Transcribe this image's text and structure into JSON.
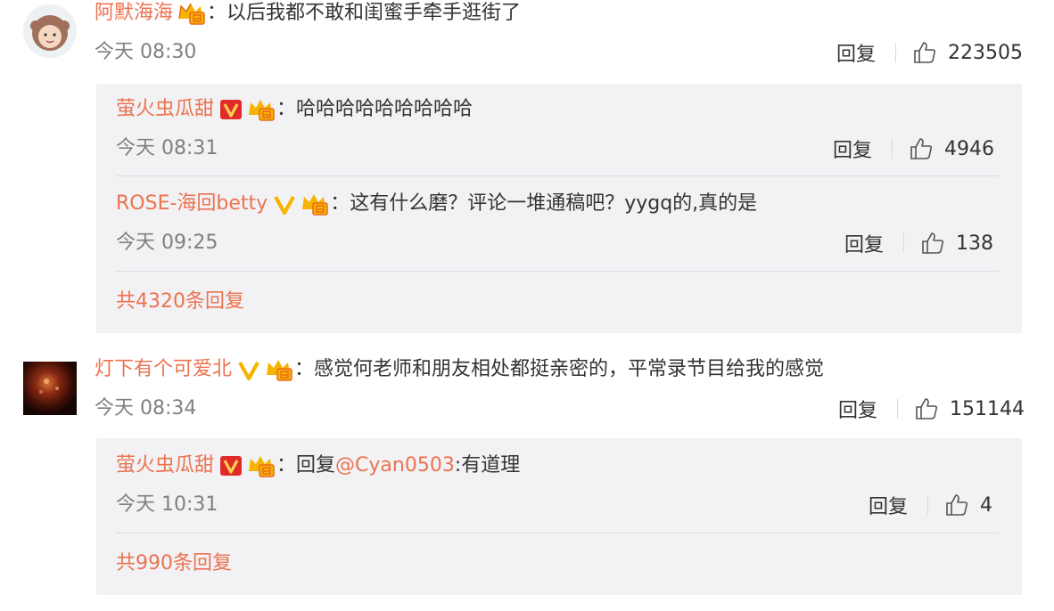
{
  "comments": [
    {
      "username": "阿默海海",
      "text": "以后我都不敢和闺蜜手牵手逛街了",
      "time": "今天 08:30",
      "reply_label": "回复",
      "likes": "223505",
      "replies": [
        {
          "username": "萤火虫瓜甜",
          "text": "哈哈哈哈哈哈哈哈哈",
          "time": "今天 08:31",
          "reply_label": "回复",
          "likes": "4946"
        },
        {
          "username": "ROSE-海回betty",
          "text": "这有什么磨？评论一堆通稿吧？yygq的,真的是",
          "time": "今天 09:25",
          "reply_label": "回复",
          "likes": "138"
        }
      ],
      "more_replies": "共4320条回复"
    },
    {
      "username": "灯下有个可爱北",
      "text": "感觉何老师和朋友相处都挺亲密的，平常录节目给我的感觉",
      "time": "今天 08:34",
      "reply_label": "回复",
      "likes": "151144",
      "replies": [
        {
          "username": "萤火虫瓜甜",
          "text": "回复",
          "mention": "@Cyan0503",
          "text_after": ":有道理",
          "time": "今天 10:31",
          "reply_label": "回复",
          "likes": "4"
        }
      ],
      "more_replies": "共990条回复"
    }
  ],
  "colors": {
    "username": "#eb7350",
    "text": "#333333",
    "time": "#808080",
    "reply_bg": "#f2f2f5",
    "badge_v": "#f6b400",
    "badge_v_red": "#e12b2b"
  },
  "icons": {
    "like": "thumb-up-icon",
    "verified_gold": "gold-v-badge-icon",
    "verified_red": "red-v-badge-icon",
    "vip_crown": "vip-crown-icon"
  }
}
